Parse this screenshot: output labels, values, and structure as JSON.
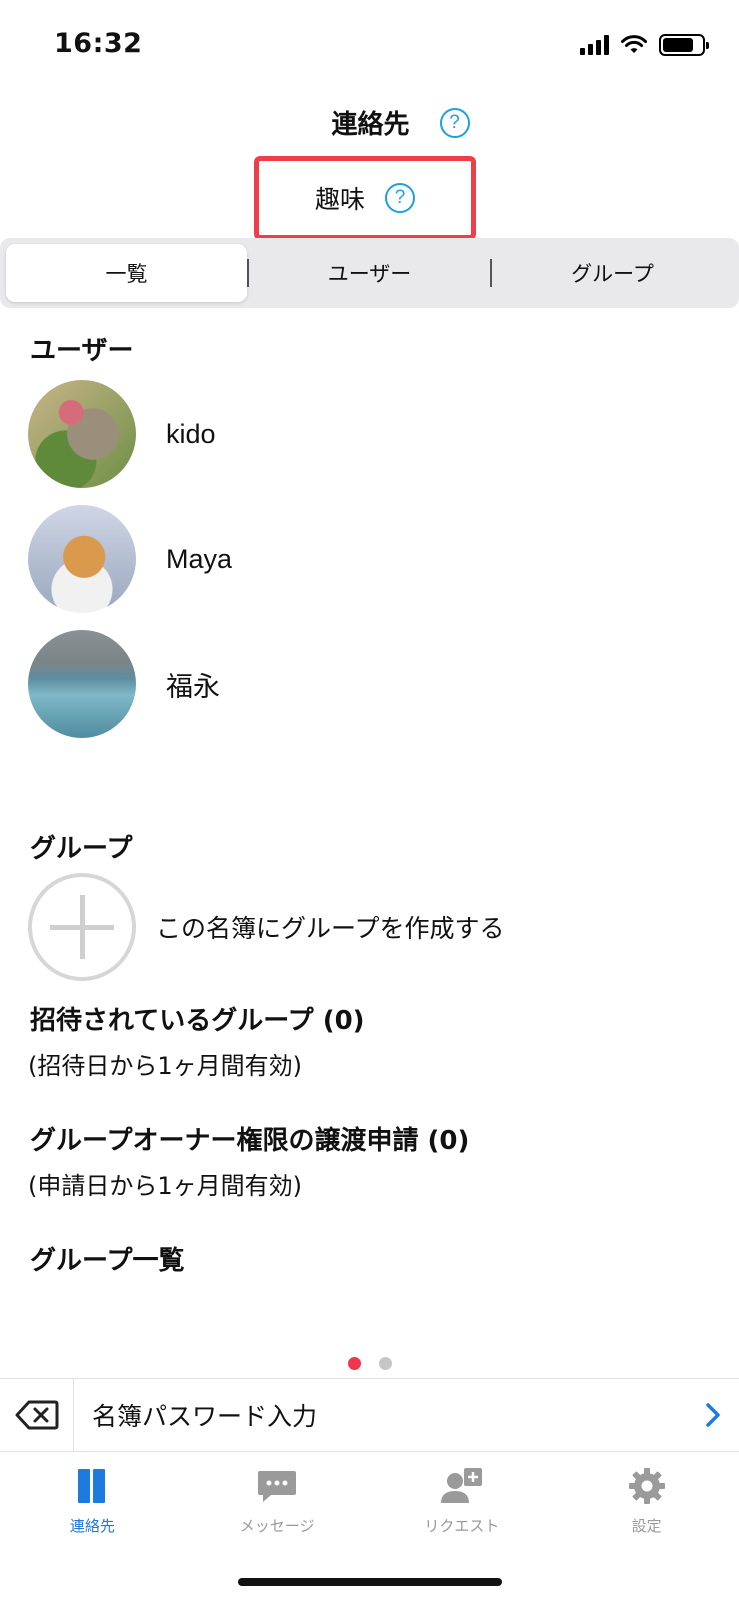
{
  "status_bar": {
    "time": "16:32"
  },
  "header": {
    "title": "連絡先",
    "help": "?"
  },
  "directory": {
    "name": "趣味",
    "help": "?"
  },
  "segments": [
    {
      "label": "一覧",
      "active": true
    },
    {
      "label": "ユーザー",
      "active": false
    },
    {
      "label": "グループ",
      "active": false
    }
  ],
  "users_section": {
    "title": "ユーザー",
    "users": [
      {
        "name": "kido"
      },
      {
        "name": "Maya"
      },
      {
        "name": "福永"
      }
    ]
  },
  "groups_section": {
    "title": "グループ",
    "create_label": "この名簿にグループを作成する",
    "invited_title": "招待されているグループ (0)",
    "invited_note": "(招待日から1ヶ月間有効)",
    "transfer_title": "グループオーナー権限の譲渡申請 (0)",
    "transfer_note": "(申請日から1ヶ月間有効)",
    "list_title": "グループ一覧"
  },
  "pager": {
    "pages": 2,
    "current": 1
  },
  "password_bar": {
    "label": "名簿パスワード入力"
  },
  "tab_bar": [
    {
      "label": "連絡先",
      "icon": "contacts-icon",
      "active": true
    },
    {
      "label": "メッセージ",
      "icon": "message-icon",
      "active": false
    },
    {
      "label": "リクエスト",
      "icon": "request-icon",
      "active": false
    },
    {
      "label": "設定",
      "icon": "gear-icon",
      "active": false
    }
  ],
  "colors": {
    "accent": "#1f7ae0",
    "help": "#1ea0e0",
    "highlight": "#ee3e4a",
    "dot_active": "#f0364e"
  }
}
